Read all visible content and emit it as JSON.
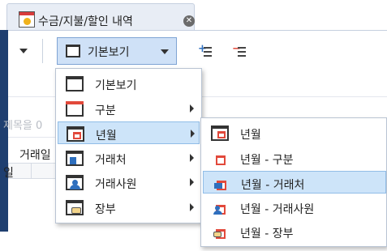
{
  "tab": {
    "title": "수금/지불/할인 내역",
    "close_glyph": "✕"
  },
  "toolbar": {
    "view_label": "기본보기"
  },
  "background": {
    "search_placeholder": "제목을 0",
    "col1": "거래일",
    "col2": "일"
  },
  "view_menu": {
    "items": [
      {
        "label": "기본보기",
        "icon": "window-icon",
        "submenu": false
      },
      {
        "label": "구분",
        "icon": "category-window-icon",
        "submenu": true
      },
      {
        "label": "년월",
        "icon": "calendar-icon",
        "submenu": true,
        "highlighted": true
      },
      {
        "label": "거래처",
        "icon": "company-icon",
        "submenu": true
      },
      {
        "label": "거래사원",
        "icon": "person-icon",
        "submenu": true
      },
      {
        "label": "장부",
        "icon": "ledger-icon",
        "submenu": true
      }
    ]
  },
  "submenu": {
    "items": [
      {
        "label": "년월",
        "icon": "calendar-window-icon"
      },
      {
        "label": "년월 - 구분",
        "icon": "calendar-category-icon"
      },
      {
        "label": "년월 - 거래처",
        "icon": "calendar-company-icon",
        "highlighted": true
      },
      {
        "label": "년월 - 거래사원",
        "icon": "calendar-person-icon"
      },
      {
        "label": "년월 - 장부",
        "icon": "calendar-ledger-icon"
      }
    ]
  },
  "colors": {
    "highlight": "#cde4f9",
    "highlight_border": "#91bde7",
    "accent_red": "#e2493b",
    "accent_blue": "#2e6fbe",
    "navy_edge": "#1f3f70"
  }
}
